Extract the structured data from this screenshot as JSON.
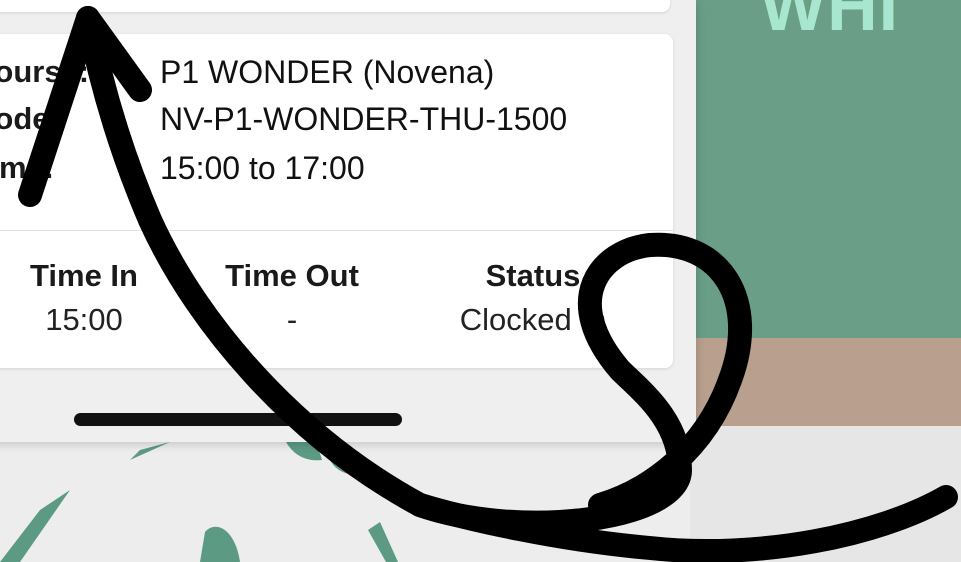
{
  "backdrop": {
    "headline": "WHI",
    "colors": {
      "green": "#6a9e87",
      "tan": "#b9a08e",
      "headline": "#a8e6cf",
      "page": "#ededed"
    }
  },
  "session": {
    "course_label": "Course:",
    "course_value": "P1 WONDER (Novena)",
    "code_label": "Code:",
    "code_value": "NV-P1-WONDER-THU-1500",
    "time_label": "Time:",
    "time_value": "15:00 to 17:00"
  },
  "attendance": {
    "time_in_header": "Time In",
    "time_in_value": "15:00",
    "time_out_header": "Time Out",
    "time_out_value": "-",
    "status_header": "Status",
    "status_value": "Clocked In"
  },
  "icons": {
    "overlay": "hand-drawn-arrow-icon",
    "decoration": "leaf-icon"
  }
}
